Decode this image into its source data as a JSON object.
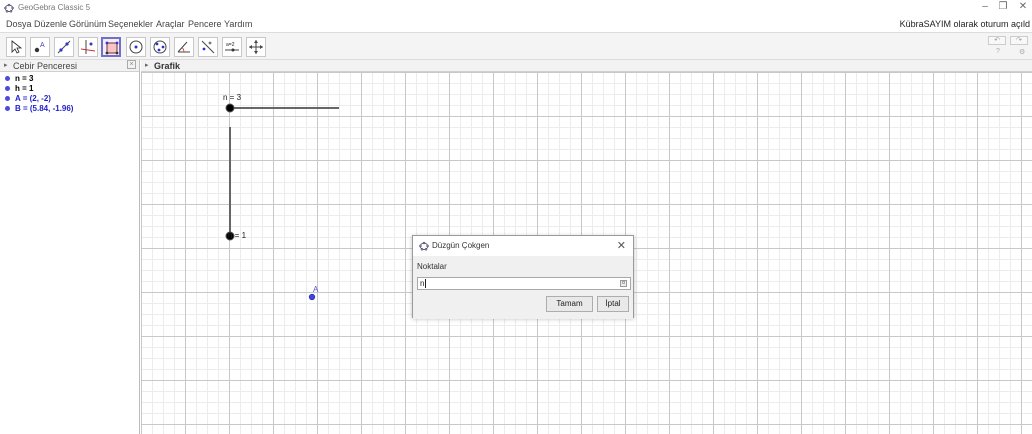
{
  "window": {
    "title": "GeoGebra Classic 5",
    "controls": [
      "–",
      "❐",
      "✕"
    ]
  },
  "menu": {
    "items": [
      "Dosya",
      "Düzenle",
      "Görünüm",
      "Seçenekler",
      "Araçlar",
      "Pencere",
      "Yardım"
    ],
    "login_text": "KübraSAYIM olarak oturum açıld"
  },
  "toolbar": {
    "tools": [
      "move-tool",
      "point-tool",
      "line-tool",
      "perpendicular-line-tool",
      "regular-polygon-tool",
      "circle-tool",
      "ellipse-tool",
      "angle-tool",
      "reflect-tool",
      "slider-tool",
      "move-graphics-tool"
    ],
    "active_tool": "regular-polygon-tool",
    "slider_tool_text": "a=2",
    "undo_label": "↶",
    "redo_label": "↷",
    "help_icon": "?",
    "settings_icon": "⚙"
  },
  "algebra": {
    "header": "Cebir Penceresi",
    "items": [
      {
        "text": "n = 3",
        "color": "#000000"
      },
      {
        "text": "h = 1",
        "color": "#000000"
      },
      {
        "text": "A = (2, -2)",
        "color": "#2222cc"
      },
      {
        "text": "B = (5.84, -1.96)",
        "color": "#2222cc"
      }
    ],
    "dot_color": "#4a4adb"
  },
  "graphics": {
    "header": "Grafik",
    "slider_n_label": "n = 3",
    "slider_h_label": "h = 1",
    "point_a_label": "A"
  },
  "dialog": {
    "title": "Düzgün Çokgen",
    "section_label": "Noktalar",
    "input_value": "n",
    "keyboard_icon": "α",
    "ok_label": "Tamam",
    "cancel_label": "İptal",
    "close_glyph": "✕"
  }
}
